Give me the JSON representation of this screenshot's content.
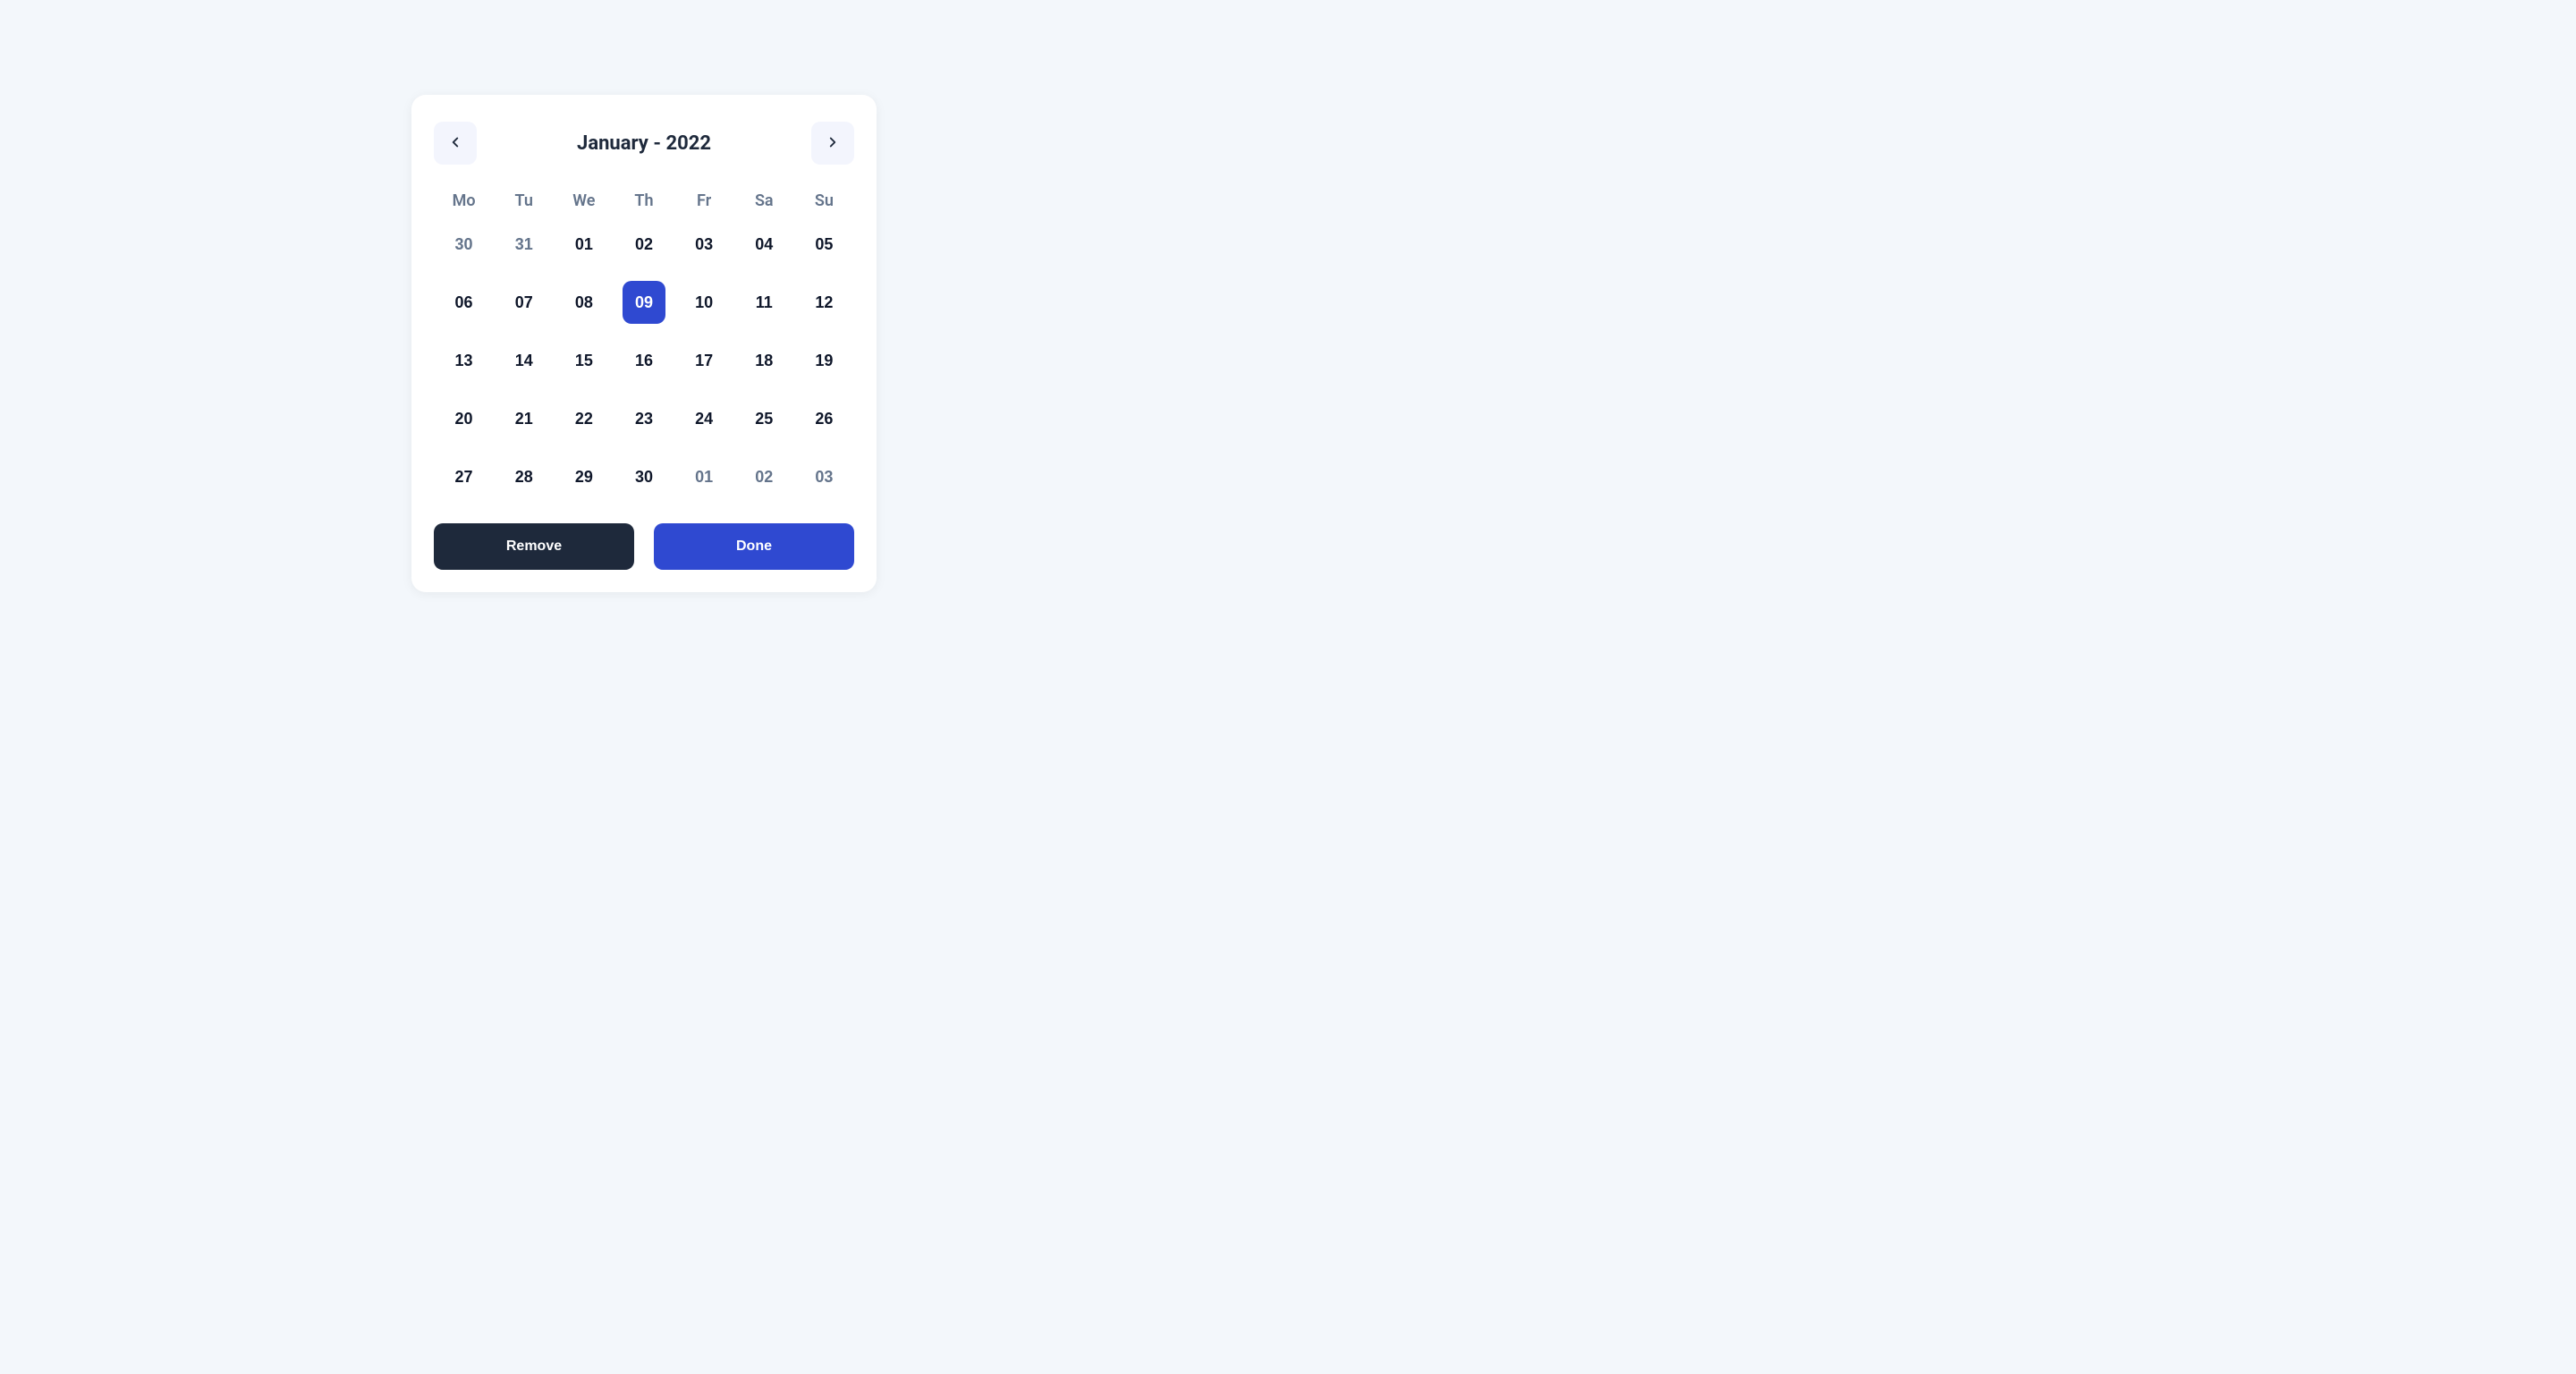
{
  "header": {
    "title": "January - 2022"
  },
  "weekdays": [
    "Mo",
    "Tu",
    "We",
    "Th",
    "Fr",
    "Sa",
    "Su"
  ],
  "days": [
    {
      "label": "30",
      "outside": true,
      "selected": false
    },
    {
      "label": "31",
      "outside": true,
      "selected": false
    },
    {
      "label": "01",
      "outside": false,
      "selected": false
    },
    {
      "label": "02",
      "outside": false,
      "selected": false
    },
    {
      "label": "03",
      "outside": false,
      "selected": false
    },
    {
      "label": "04",
      "outside": false,
      "selected": false
    },
    {
      "label": "05",
      "outside": false,
      "selected": false
    },
    {
      "label": "06",
      "outside": false,
      "selected": false
    },
    {
      "label": "07",
      "outside": false,
      "selected": false
    },
    {
      "label": "08",
      "outside": false,
      "selected": false
    },
    {
      "label": "09",
      "outside": false,
      "selected": true
    },
    {
      "label": "10",
      "outside": false,
      "selected": false
    },
    {
      "label": "11",
      "outside": false,
      "selected": false
    },
    {
      "label": "12",
      "outside": false,
      "selected": false
    },
    {
      "label": "13",
      "outside": false,
      "selected": false
    },
    {
      "label": "14",
      "outside": false,
      "selected": false
    },
    {
      "label": "15",
      "outside": false,
      "selected": false
    },
    {
      "label": "16",
      "outside": false,
      "selected": false
    },
    {
      "label": "17",
      "outside": false,
      "selected": false
    },
    {
      "label": "18",
      "outside": false,
      "selected": false
    },
    {
      "label": "19",
      "outside": false,
      "selected": false
    },
    {
      "label": "20",
      "outside": false,
      "selected": false
    },
    {
      "label": "21",
      "outside": false,
      "selected": false
    },
    {
      "label": "22",
      "outside": false,
      "selected": false
    },
    {
      "label": "23",
      "outside": false,
      "selected": false
    },
    {
      "label": "24",
      "outside": false,
      "selected": false
    },
    {
      "label": "25",
      "outside": false,
      "selected": false
    },
    {
      "label": "26",
      "outside": false,
      "selected": false
    },
    {
      "label": "27",
      "outside": false,
      "selected": false
    },
    {
      "label": "28",
      "outside": false,
      "selected": false
    },
    {
      "label": "29",
      "outside": false,
      "selected": false
    },
    {
      "label": "30",
      "outside": false,
      "selected": false
    },
    {
      "label": "01",
      "outside": true,
      "selected": false
    },
    {
      "label": "02",
      "outside": true,
      "selected": false
    },
    {
      "label": "03",
      "outside": true,
      "selected": false
    }
  ],
  "actions": {
    "remove": "Remove",
    "done": "Done"
  },
  "colors": {
    "accent": "#2f49d1",
    "dark": "#1e293b"
  }
}
